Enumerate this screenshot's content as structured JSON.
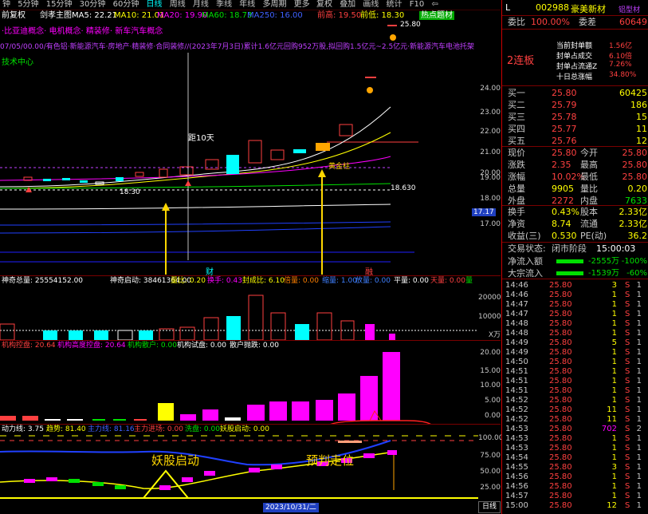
{
  "toolbar": {
    "items": [
      "钟",
      "5分钟",
      "15分钟",
      "30分钟",
      "60分钟",
      "日线",
      "周线",
      "月线",
      "季线",
      "年线",
      "多周期",
      "更多"
    ],
    "right_items": [
      "复权",
      "叠加",
      "画线",
      "统计",
      "F10",
      "⇦"
    ]
  },
  "chartinfo": {
    "period": "前复权",
    "main": "剑孝主图",
    "ma5": "MA5: 22.21",
    "ma10": "MA10: 21.01",
    "ma20": "MA20: 19.90",
    "ma60": "MA60: 18.73",
    "ma250": "MA250: 16.00",
    "high_label": "前高: 19.50",
    "prev_high": "前低: 18.30",
    "tag": "热点题材"
  },
  "news_line": "07/05/00.00/有色铝·新能源汽车·房地产·精装修·合同装修//(2023年7月3日)累计1.6亿元回购952万股,拟回购1.5亿元~2.5亿元·新能源汽车电池托架",
  "concept_line": "·比亚迪概念· 电机概念· 精装修· 新车汽车概念",
  "tech_label": "技术中心",
  "price_scale": [
    "24.00",
    "23.00",
    "22.00",
    "21.00",
    "20.00",
    "19.00",
    "18.00",
    "17.00"
  ],
  "price_top_label": "25.80",
  "current_price_tag": "17.17",
  "annotations": {
    "days": "距10天",
    "low_mark": "18.30",
    "level_right": "18.630",
    "golden": "黄金柱",
    "cai": "财",
    "rong": "融"
  },
  "vol_header": {
    "vol_total": "神奇总量: 25554152.00",
    "vol_start": "神奇启动: 38461364.00",
    "ratio": "量比: 0.20",
    "turnover": "换手: 0.43",
    "seal": "封成比: 6.10",
    "multi": "倍量: 0.00",
    "shrink": "缩量: 1.00",
    "surge": "放量: 0.00",
    "flat": "平量: 0.00",
    "sky": "天量: 0.00",
    "quantity": "量"
  },
  "vol_scale": [
    "20000",
    "10000",
    "X万"
  ],
  "inst_header": {
    "a": "机构控盘: 20.64",
    "b": "机构高度控盘: 20.64",
    "c": "机构散户: 0.00",
    "d": "机构试盘: 0.00",
    "e": "散户抛跌: 0.00"
  },
  "inst_scale": [
    "20.00",
    "15.00",
    "10.00",
    "5.00",
    "0.00"
  ],
  "power_header": {
    "a": "动力线: 3.75",
    "b": "趋势: 81.40",
    "c": "主力线: 81.16",
    "d": "主力进场: 0.00",
    "e": "洗盘: 0.00",
    "f": "妖股启动: 0.00"
  },
  "power_scale": [
    "100.00",
    "75.00",
    "50.00",
    "25.00"
  ],
  "power_labels": {
    "start": "妖股启动",
    "predict": "预判走位"
  },
  "date_label": "2023/10/31/二",
  "period_tab": "日线",
  "quote": {
    "flag": "L",
    "code": "002988",
    "name": "豪美新材",
    "tag": "铝型材",
    "weibi_lbl": "委比",
    "weibi": "100.00%",
    "weicha_lbl": "委差",
    "weicha": "60649",
    "seal_title1": "当前封单额",
    "seal_val1": "1.56亿",
    "seal_title2": "封单占成交",
    "seal_val2": "6.10倍",
    "seal_title3": "封单占流通Z",
    "seal_val3": "7.26%",
    "seal_title4": "十日总涨幅",
    "seal_val4": "34.80%",
    "board": "2连板",
    "buys": [
      {
        "lbl": "买一",
        "p": "25.80",
        "v": "60425"
      },
      {
        "lbl": "买二",
        "p": "25.79",
        "v": "186"
      },
      {
        "lbl": "买三",
        "p": "25.78",
        "v": "15"
      },
      {
        "lbl": "买四",
        "p": "25.77",
        "v": "11"
      },
      {
        "lbl": "买五",
        "p": "25.76",
        "v": "12"
      }
    ],
    "stats": [
      {
        "l1": "现价",
        "v1": "25.80",
        "l2": "今开",
        "v2": "25.80"
      },
      {
        "l1": "涨跌",
        "v1": "2.35",
        "l2": "最高",
        "v2": "25.80"
      },
      {
        "l1": "涨幅",
        "v1": "10.02%",
        "l2": "最低",
        "v2": "25.80"
      },
      {
        "l1": "总量",
        "v1": "9905",
        "l2": "量比",
        "v2": "0.20"
      },
      {
        "l1": "外盘",
        "v1": "2272",
        "l2": "内盘",
        "v2": "7633"
      }
    ],
    "stats2": [
      {
        "l1": "换手",
        "v1": "0.43%",
        "l2": "股本",
        "v2": "2.33亿"
      },
      {
        "l1": "净资",
        "v1": "8.74",
        "l2": "流通",
        "v2": "2.33亿"
      },
      {
        "l1": "收益(三)",
        "v1": "0.530",
        "l2": "PE(动)",
        "v2": "36.2"
      }
    ],
    "trade_state_lbl": "交易状态:",
    "trade_state": "闭市阶段",
    "trade_time": "15:00:03",
    "inflow_lbl": "净流入额",
    "inflow_val": "-2555万",
    "inflow_pct": "-100%",
    "big_lbl": "大宗流入",
    "big_val": "-1539万",
    "big_pct": "-60%"
  },
  "ticks": [
    {
      "t": "14:46",
      "p": "25.80",
      "v": "3",
      "s": "S",
      "n": "1"
    },
    {
      "t": "14:46",
      "p": "25.80",
      "v": "1",
      "s": "S",
      "n": "1"
    },
    {
      "t": "14:47",
      "p": "25.80",
      "v": "1",
      "s": "S",
      "n": "1"
    },
    {
      "t": "14:47",
      "p": "25.80",
      "v": "1",
      "s": "S",
      "n": "1"
    },
    {
      "t": "14:48",
      "p": "25.80",
      "v": "1",
      "s": "S",
      "n": "1"
    },
    {
      "t": "14:48",
      "p": "25.80",
      "v": "1",
      "s": "S",
      "n": "1"
    },
    {
      "t": "14:49",
      "p": "25.80",
      "v": "5",
      "s": "S",
      "n": "1"
    },
    {
      "t": "14:49",
      "p": "25.80",
      "v": "1",
      "s": "S",
      "n": "1"
    },
    {
      "t": "14:50",
      "p": "25.80",
      "v": "1",
      "s": "S",
      "n": "1"
    },
    {
      "t": "14:51",
      "p": "25.80",
      "v": "1",
      "s": "S",
      "n": "1"
    },
    {
      "t": "14:51",
      "p": "25.80",
      "v": "1",
      "s": "S",
      "n": "1"
    },
    {
      "t": "14:51",
      "p": "25.80",
      "v": "1",
      "s": "S",
      "n": "1"
    },
    {
      "t": "14:52",
      "p": "25.80",
      "v": "1",
      "s": "S",
      "n": "1"
    },
    {
      "t": "14:52",
      "p": "25.80",
      "v": "11",
      "s": "S",
      "n": "1"
    },
    {
      "t": "14:52",
      "p": "25.80",
      "v": "11",
      "s": "S",
      "n": "1"
    },
    {
      "t": "14:53",
      "p": "25.80",
      "v": "702",
      "s": "S",
      "n": "2"
    },
    {
      "t": "14:53",
      "p": "25.80",
      "v": "1",
      "s": "S",
      "n": "1"
    },
    {
      "t": "14:53",
      "p": "25.80",
      "v": "1",
      "s": "S",
      "n": "1"
    },
    {
      "t": "14:54",
      "p": "25.80",
      "v": "1",
      "s": "S",
      "n": "1"
    },
    {
      "t": "14:55",
      "p": "25.80",
      "v": "3",
      "s": "S",
      "n": "1"
    },
    {
      "t": "14:56",
      "p": "25.80",
      "v": "1",
      "s": "S",
      "n": "1"
    },
    {
      "t": "14:56",
      "p": "25.80",
      "v": "1",
      "s": "S",
      "n": "1"
    },
    {
      "t": "14:57",
      "p": "25.80",
      "v": "1",
      "s": "S",
      "n": "1"
    },
    {
      "t": "15:00",
      "p": "25.80",
      "v": "12",
      "s": "S",
      "n": "1"
    }
  ],
  "colors": {
    "up": "#ff4040",
    "down": "#00ffff",
    "magenta": "#ff00ff",
    "yellow": "#ffff00",
    "orange": "#ffa500"
  }
}
